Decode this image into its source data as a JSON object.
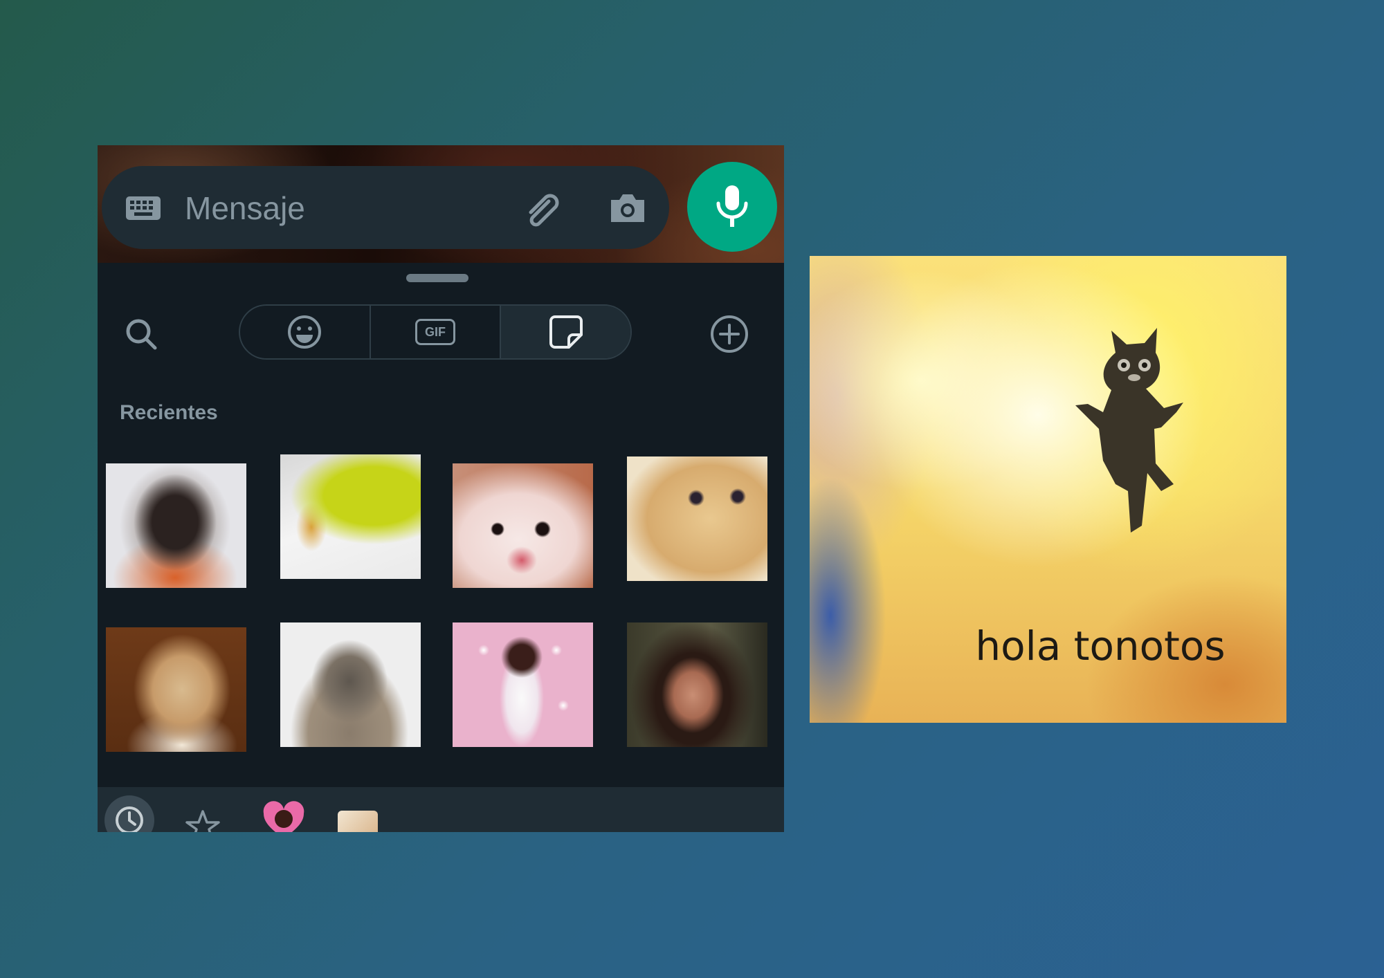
{
  "composer": {
    "placeholder": "Mensaje",
    "icons": {
      "keyboard": "keyboard-icon",
      "attach": "paperclip-icon",
      "camera": "camera-icon",
      "mic": "microphone-icon"
    }
  },
  "picker": {
    "tabs": [
      {
        "name": "emoji",
        "icon": "emoji-icon",
        "active": false
      },
      {
        "name": "gif",
        "label": "GIF",
        "active": false
      },
      {
        "name": "stickers",
        "icon": "sticker-icon",
        "active": true
      }
    ],
    "section_title": "Recientes",
    "stickers": [
      "monkey-sticker",
      "baby-monkey-sticker",
      "white-kitten-sticker",
      "orange-cat-sticker",
      "dog-sticker",
      "seal-sticker",
      "dancing-character-sticker",
      "woman-sticker"
    ],
    "pack_bar": [
      "recent-icon",
      "star-icon",
      "heart-pack",
      "sticker-pack"
    ]
  },
  "meme": {
    "caption": "hola tonotos"
  },
  "colors": {
    "accent": "#00a884",
    "panel": "#121b22",
    "bar": "#1f2c34",
    "muted": "#8696a0"
  }
}
